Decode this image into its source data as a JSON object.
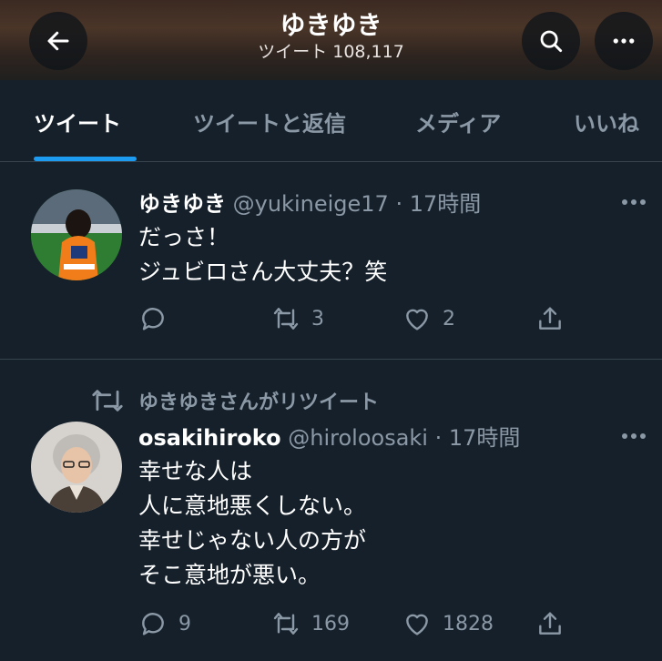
{
  "header": {
    "title": "ゆきゆき",
    "subtitle": "ツイート 108,117"
  },
  "tabs": [
    {
      "label": "ツイート",
      "active": true
    },
    {
      "label": "ツイートと返信",
      "active": false
    },
    {
      "label": "メディア",
      "active": false
    },
    {
      "label": "いいね",
      "active": false
    }
  ],
  "tweets": [
    {
      "name": "ゆきゆき",
      "handle": "@yukineige17",
      "separator": "·",
      "time": "17時間",
      "lines": [
        "だっさ！",
        "ジュビロさん大丈夫？笑"
      ],
      "reply_count": "",
      "retweet_count": "3",
      "like_count": "2"
    },
    {
      "retweet_notice": "ゆきゆきさんがリツイート",
      "name": "osakihiroko",
      "handle": "@hiroloosaki",
      "separator": "·",
      "time": "17時間",
      "lines": [
        "幸せな人は",
        "人に意地悪くしない。",
        "幸せじゃない人の方が",
        "そこ意地が悪い。"
      ],
      "reply_count": "9",
      "retweet_count": "169",
      "like_count": "1828"
    }
  ],
  "icons": {
    "back": "arrow-left-icon",
    "search": "search-icon",
    "more": "more-dots-icon",
    "reply": "reply-icon",
    "retweet": "retweet-icon",
    "like": "heart-icon",
    "share": "share-icon"
  },
  "colors": {
    "background": "#15202b",
    "accent": "#1d9bf0",
    "muted": "#8b98a5",
    "border": "#38444d"
  }
}
